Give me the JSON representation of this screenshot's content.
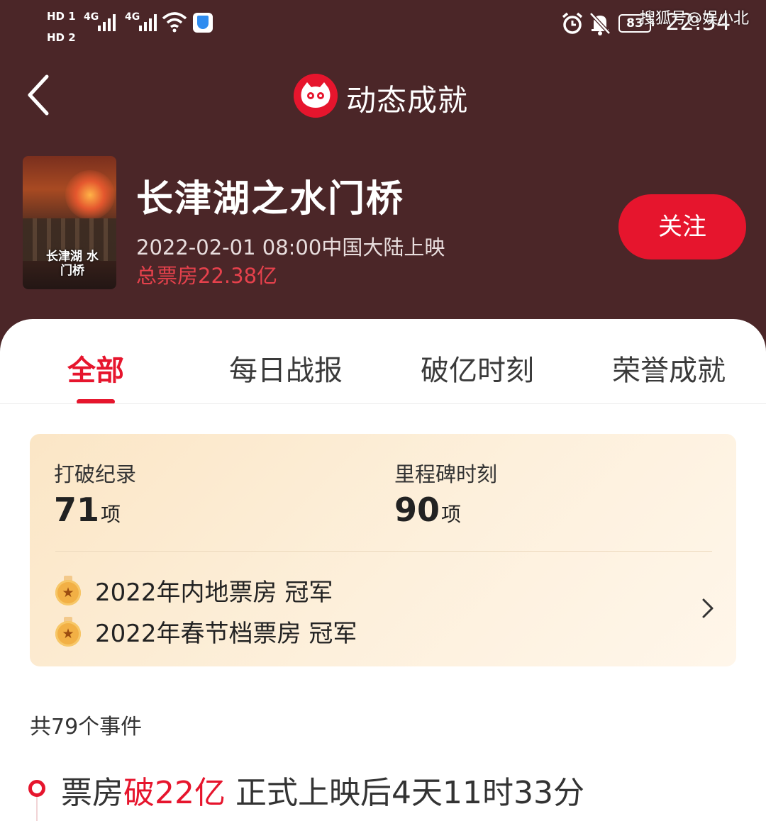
{
  "status_bar": {
    "hd1": "HD 1",
    "hd2": "HD 2",
    "sig1": "4G",
    "sig2": "4G",
    "battery": "83",
    "time": "22:34",
    "watermark": "搜狐号@娱小北"
  },
  "nav": {
    "title": "动态成就",
    "back_icon": "chevron-left-icon",
    "logo_icon": "cat-logo-icon"
  },
  "movie": {
    "title": "长津湖之水门桥",
    "poster_title": "长津湖 水门桥",
    "release": "2022-02-01 08:00中国大陆上映",
    "box_office": "总票房22.38亿",
    "follow_label": "关注"
  },
  "tabs": [
    {
      "label": "全部",
      "active": true
    },
    {
      "label": "每日战报",
      "active": false
    },
    {
      "label": "破亿时刻",
      "active": false
    },
    {
      "label": "荣誉成就",
      "active": false
    }
  ],
  "stats": {
    "records_label": "打破纪录",
    "records_value": "71",
    "records_unit": "项",
    "milestones_label": "里程碑时刻",
    "milestones_value": "90",
    "milestones_unit": "项"
  },
  "honors": [
    {
      "text": "2022年内地票房 冠军",
      "icon": "medal-icon"
    },
    {
      "text": "2022年春节档票房 冠军",
      "icon": "medal-icon"
    }
  ],
  "events": {
    "count_label": "共79个事件",
    "first": {
      "prefix": "票房",
      "highlight": "破22亿",
      "suffix": " 正式上映后4天11时33分"
    }
  },
  "colors": {
    "header_bg": "#4b2628",
    "accent": "#e6152d",
    "card_bg": "#fbe6c6"
  }
}
